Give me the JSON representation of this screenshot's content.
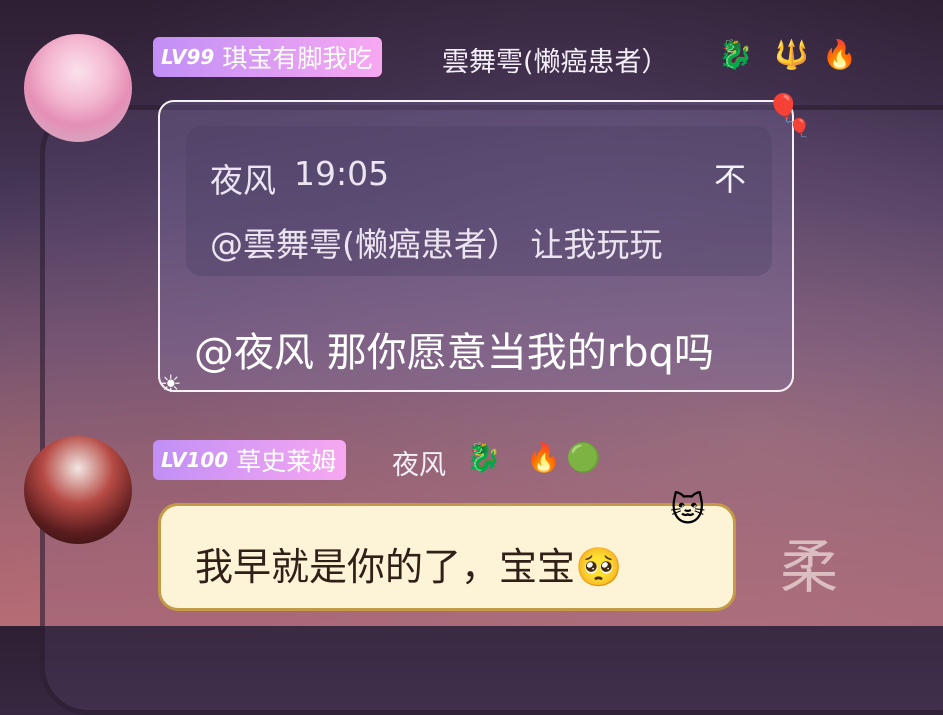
{
  "messages": [
    {
      "badge_level": "LV99",
      "badge_title": "琪宝有脚我吃",
      "nickname": "雲舞雩(懒癌患者）",
      "icons": [
        "dragon-icon",
        "crest-icon",
        "fire-icon"
      ],
      "quote": {
        "name": "夜风",
        "time": "19:05",
        "right": "不",
        "text": "@雲舞雩(懒癌患者） 让我玩玩"
      },
      "text": "@夜风 那你愿意当我的rbq吗"
    },
    {
      "badge_level": "LV100",
      "badge_title": "草史莱姆",
      "nickname": "夜风",
      "icons": [
        "dragon-icon",
        "fire-icon",
        "slime-icon"
      ],
      "text": "我早就是你的了，宝宝"
    }
  ],
  "background_text": "柔",
  "colors": {
    "badge_gradient_start": "#c18ff6",
    "badge_gradient_end": "#f7a8f1",
    "bubble2_bg": "#fdf4d8",
    "bubble2_border": "#c39a46"
  }
}
